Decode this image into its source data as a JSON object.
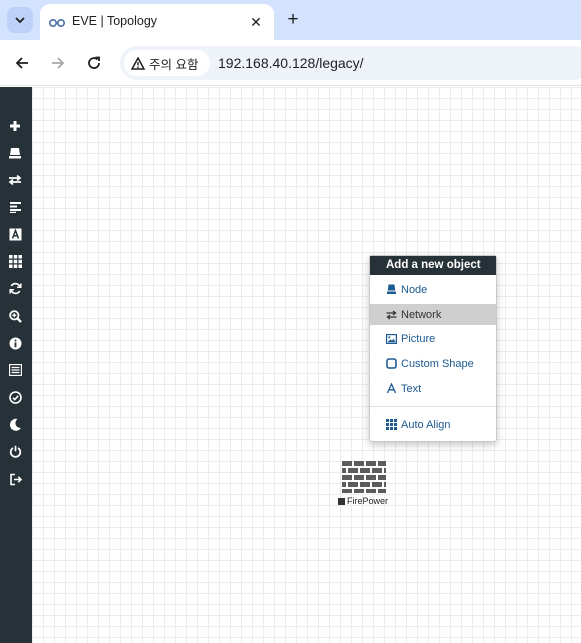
{
  "browser": {
    "tab": {
      "title": "EVE | Topology"
    },
    "new_tab_label": "+",
    "close_label": "✕",
    "security_chip_label": "주의 요함",
    "url": "192.168.40.128/legacy/"
  },
  "sidebar": {
    "items": [
      {
        "icon": "plus-icon"
      },
      {
        "icon": "node-icon"
      },
      {
        "icon": "network-exchange-icon"
      },
      {
        "icon": "align-left-icon"
      },
      {
        "icon": "text-font-icon"
      },
      {
        "icon": "grid-icon"
      },
      {
        "icon": "refresh-icon"
      },
      {
        "icon": "zoom-icon"
      },
      {
        "icon": "info-icon"
      },
      {
        "icon": "list-icon"
      },
      {
        "icon": "check-circle-icon"
      },
      {
        "icon": "moon-icon"
      },
      {
        "icon": "power-icon"
      },
      {
        "icon": "logout-icon"
      }
    ]
  },
  "context_menu": {
    "title": "Add a new object",
    "items": [
      {
        "label": "Node",
        "icon": "node-icon"
      },
      {
        "label": "Network",
        "icon": "exchange-icon"
      },
      {
        "label": "Picture",
        "icon": "picture-icon"
      },
      {
        "label": "Custom Shape",
        "icon": "square-icon"
      },
      {
        "label": "Text",
        "icon": "font-icon"
      },
      {
        "label": "Auto Align",
        "icon": "grid-icon"
      }
    ]
  },
  "canvas": {
    "node": {
      "label": "FirePower",
      "icon": "firewall-icon"
    }
  },
  "colors": {
    "sidebar_bg": "#263238",
    "menu_link": "#1d5a91",
    "menu_highlight": "#cfcfcf",
    "tabstrip_bg": "#d3e3fd"
  }
}
